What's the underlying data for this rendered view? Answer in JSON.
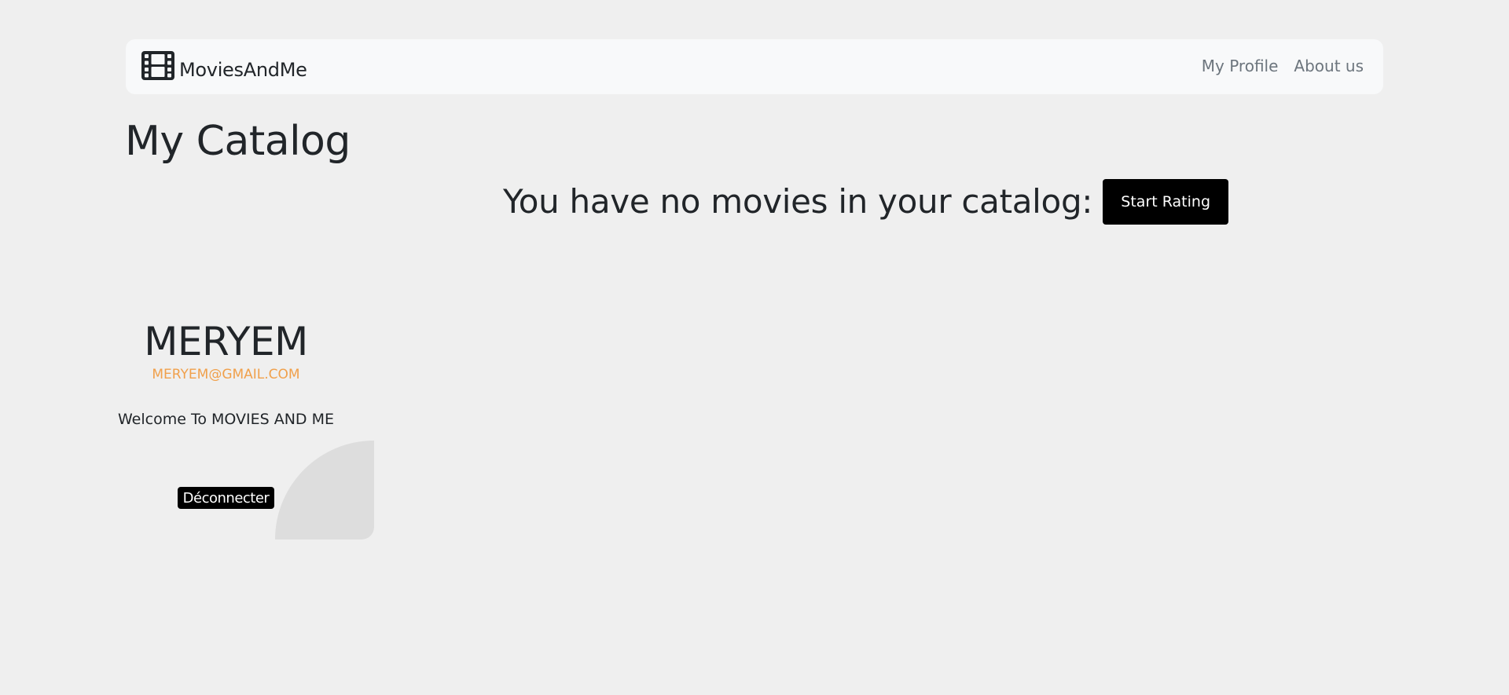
{
  "navbar": {
    "brand_icon": "film-icon",
    "brand_name": "MoviesAndMe",
    "links": [
      {
        "label": "My Profile"
      },
      {
        "label": "About us"
      }
    ]
  },
  "catalog": {
    "title": "My Catalog",
    "empty_message": "You have no movies in your catalog:",
    "start_button": "Start Rating"
  },
  "profile": {
    "name": "MERYEM",
    "email": "MERYEM@GMAIL.COM",
    "welcome": "Welcome To MOVIES AND ME",
    "logout_button": "Déconnecter"
  },
  "colors": {
    "background": "#efefef",
    "navbar_bg": "#f8f9fa",
    "email_accent": "#f0a04b",
    "button_bg": "#000000",
    "decor_shape": "#dddddd"
  }
}
